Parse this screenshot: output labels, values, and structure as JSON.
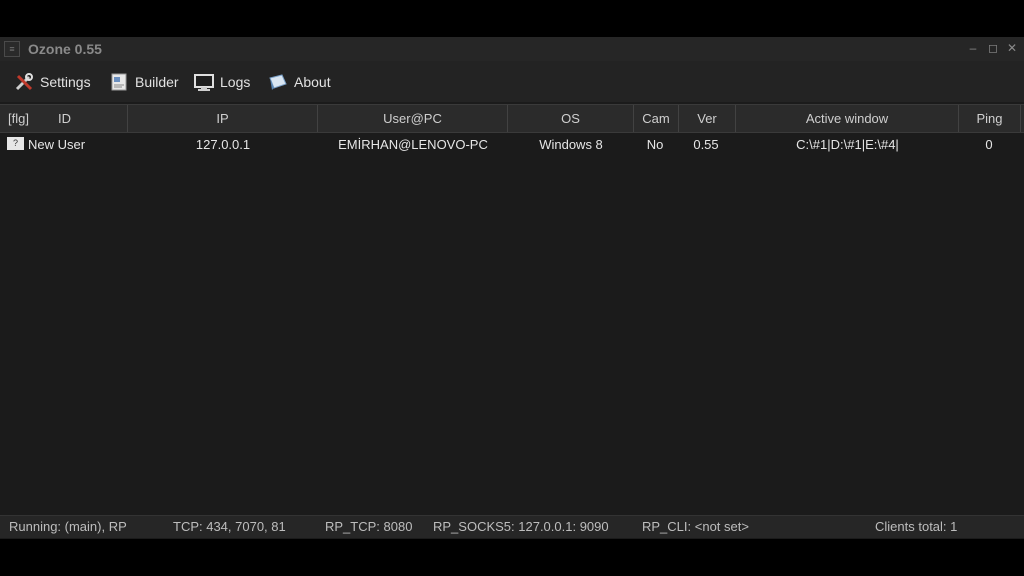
{
  "window": {
    "title": "Ozone 0.55",
    "controls": {
      "minimize": "–",
      "maximize": "◻",
      "close": "✕"
    }
  },
  "menu": {
    "items": [
      {
        "label": "Settings",
        "icon": "settings-icon"
      },
      {
        "label": "Builder",
        "icon": "builder-icon"
      },
      {
        "label": "Logs",
        "icon": "logs-icon"
      },
      {
        "label": "About",
        "icon": "about-icon"
      }
    ]
  },
  "table": {
    "columns": [
      "[flg]",
      "ID",
      "IP",
      "User@PC",
      "OS",
      "Cam",
      "Ver",
      "Active window",
      "Ping"
    ],
    "rows": [
      {
        "flag": "?",
        "id": "New User",
        "ip": "127.0.0.1",
        "user_pc": "EMİRHAN@LENOVO-PC",
        "os": "Windows 8",
        "cam": "No",
        "ver": "0.55",
        "active_window": "C:\\#1|D:\\#1|E:\\#4|",
        "ping": "0"
      }
    ]
  },
  "status": {
    "running": "Running: (main), RP",
    "tcp": "TCP: 434, 7070, 81",
    "rp_tcp": "RP_TCP: 8080",
    "rp_socks5": "RP_SOCKS5: 127.0.0.1: 9090",
    "rp_cli": "RP_CLI: <not set>",
    "clients_total": "Clients total: 1"
  },
  "colors": {
    "background": "#1b1b1b",
    "header": "#2b2b2b",
    "text": "#e6e6e6"
  }
}
